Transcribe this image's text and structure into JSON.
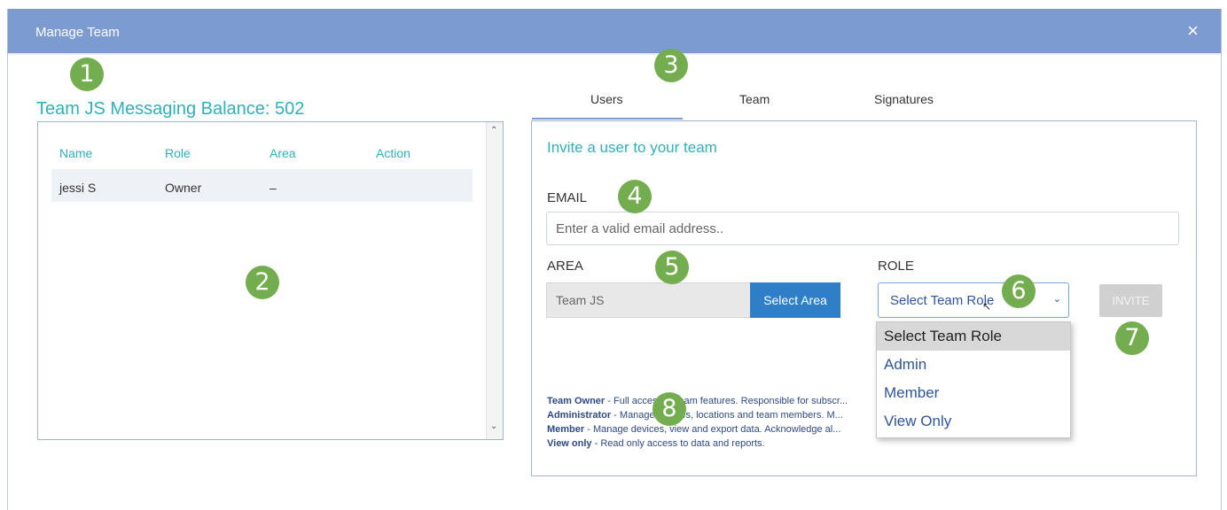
{
  "dialog": {
    "title": "Manage Team",
    "close_icon": "×"
  },
  "balance": {
    "text": "Team JS Messaging Balance: 502"
  },
  "users_table": {
    "headers": [
      "Name",
      "Role",
      "Area",
      "Action"
    ],
    "rows": [
      {
        "name": "jessi S",
        "role": "Owner",
        "area": "–",
        "action": ""
      }
    ],
    "scroll_up": "⌃",
    "scroll_down": "⌄"
  },
  "tabs": [
    {
      "label": "Users",
      "active": true
    },
    {
      "label": "Team"
    },
    {
      "label": "Signatures"
    }
  ],
  "invite": {
    "title": "Invite a user to your team",
    "email_label": "EMAIL",
    "email_placeholder": "Enter a valid email address..",
    "area_label": "AREA",
    "area_value": "Team JS",
    "select_area_button": "Select Area",
    "role_label": "ROLE",
    "role_value": "Select Team Role",
    "role_chevron": "⌄",
    "invite_button": "INVITE"
  },
  "role_options": [
    "Select Team Role",
    "Admin",
    "Member",
    "View Only"
  ],
  "help": [
    {
      "term": "Team Owner",
      "desc": " - Full access to team features. Responsible for subscr..."
    },
    {
      "term": "Administrator",
      "desc": " - Manage devices, locations and team members. M..."
    },
    {
      "term": "Member",
      "desc": " - Manage devices, view and export data. Acknowledge al..."
    },
    {
      "term": "View only",
      "desc": " - Read only access to data and reports."
    }
  ],
  "callouts": [
    "1",
    "2",
    "3",
    "4",
    "5",
    "6",
    "7",
    "8"
  ],
  "colors": {
    "header": "#7b9bd1",
    "accent_teal": "#32b0b8",
    "button_blue": "#2f7ec8",
    "callout_green": "#74ad4f"
  }
}
